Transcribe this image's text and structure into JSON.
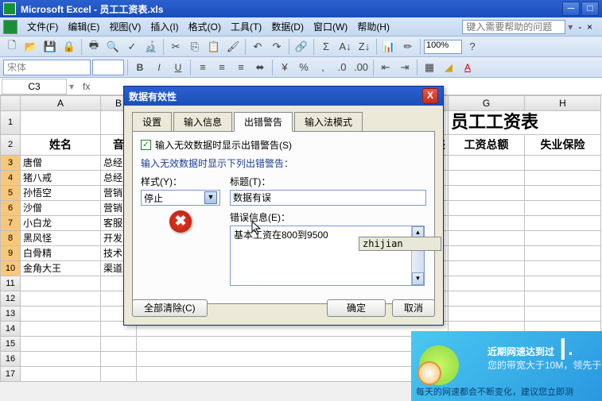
{
  "app": {
    "title": "Microsoft Excel - 员工工资表.xls"
  },
  "menu": {
    "file": "文件(F)",
    "edit": "编辑(E)",
    "view": "视图(V)",
    "insert": "插入(I)",
    "format": "格式(O)",
    "tools": "工具(T)",
    "data": "数据(D)",
    "window": "窗口(W)",
    "help": "帮助(H)",
    "help_placeholder": "键入需要帮助的问题"
  },
  "toolbar": {
    "zoom": "100%",
    "font_name": "宋体",
    "font_size": ""
  },
  "namebox": {
    "ref": "C3",
    "fx": "fx"
  },
  "cols": {
    "A": "A",
    "B": "B",
    "G": "G",
    "H": "H"
  },
  "rows": [
    "1",
    "2",
    "3",
    "4",
    "5",
    "6",
    "7",
    "8",
    "9",
    "10",
    "11",
    "12",
    "13",
    "14",
    "15",
    "16",
    "17"
  ],
  "cells": {
    "title": "员工工资表",
    "h_name": "姓名",
    "h_b": "音",
    "h_total": "工资总额",
    "h_ins": "失业保险",
    "h_g1": "差",
    "A3": "唐僧",
    "B3": "总经",
    "A4": "猪八戒",
    "B4": "总经",
    "A5": "孙悟空",
    "B5": "营销",
    "A6": "沙僧",
    "B6": "营销",
    "A7": "小白龙",
    "B7": "客服",
    "A8": "黑风怪",
    "B8": "开发",
    "A9": "白骨精",
    "B9": "技术",
    "A10": "金角大王",
    "B10": "渠道"
  },
  "dialog": {
    "title": "数据有效性",
    "tabs": {
      "settings": "设置",
      "input": "输入信息",
      "error": "出错警告",
      "ime": "输入法模式"
    },
    "chk_label": "输入无效数据时显示出错警告(S)",
    "sub": "输入无效数据时显示下列出错警告：",
    "style_lbl": "样式(Y)：",
    "style_val": "停止",
    "title_lbl": "标题(T)：",
    "title_val": "数据有误",
    "msg_lbl": "错误信息(E)：",
    "msg_val": "基本工资在800到9500",
    "clear": "全部清除(C)",
    "ok": "确定",
    "cancel": "取消"
  },
  "ime": {
    "text": "zhijian"
  },
  "ad": {
    "l1": "近期网速达到过",
    "l1b": "┃.",
    "l2": "您的带宽大于10M，领先于",
    "l3": "每天的网速都会不断变化，建议您立即测"
  }
}
